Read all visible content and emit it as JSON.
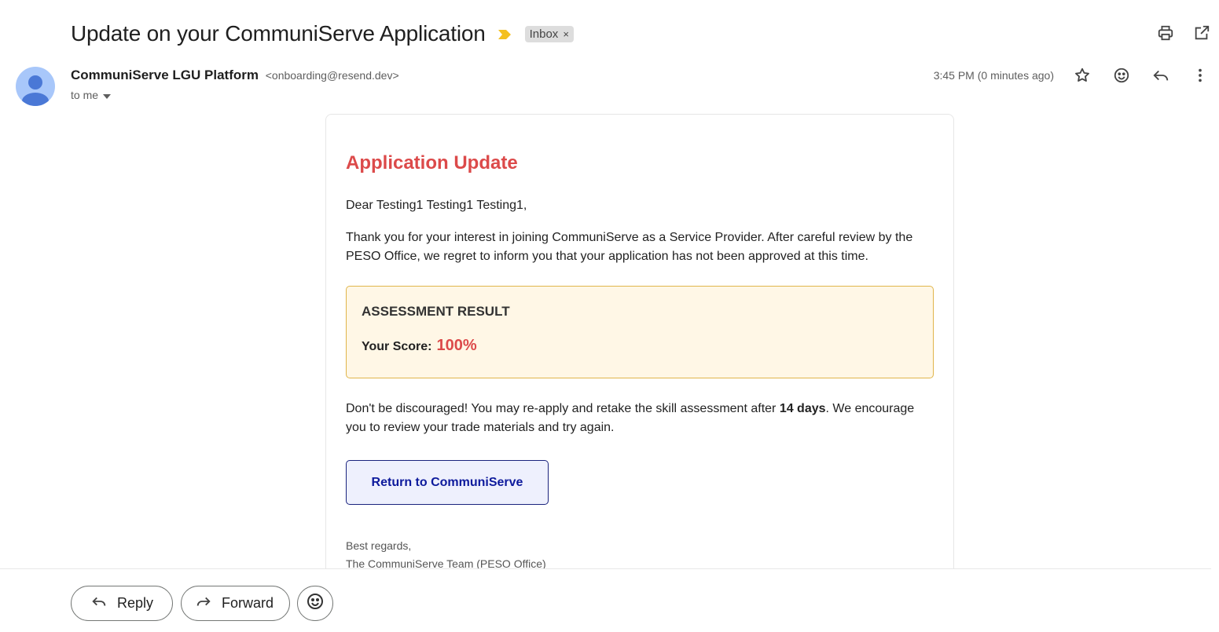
{
  "email": {
    "subject": "Update on your CommuniServe Application",
    "label": "Inbox",
    "label_remove": "×",
    "sender_name": "CommuniServe LGU Platform",
    "sender_email": "<onboarding@resend.dev>",
    "recipient": "to me",
    "timestamp": "3:45 PM (0 minutes ago)"
  },
  "body": {
    "heading": "Application Update",
    "greeting": "Dear Testing1 Testing1 Testing1,",
    "intro": "Thank you for your interest in joining CommuniServe as a Service Provider. After careful review by the PESO Office, we regret to inform you that your application has not been approved at this time.",
    "assessment_title": "ASSESSMENT RESULT",
    "score_label": "Your Score:",
    "score_value": "100%",
    "encourage_pre": "Don't be discouraged! You may re-apply and retake the skill assessment after ",
    "encourage_bold": "14 days",
    "encourage_post": ". We encourage you to review your trade materials and try again.",
    "cta_label": "Return to CommuniServe",
    "signoff_line1": "Best regards,",
    "signoff_line2": "The CommuniServe Team (PESO Office)"
  },
  "actions": {
    "reply_label": "Reply",
    "forward_label": "Forward"
  },
  "icons": {
    "importance": "importance-marker-icon",
    "print": "print-icon",
    "open_new_window": "open-in-new-window-icon",
    "star": "star-icon",
    "emoji": "emoji-icon",
    "reply": "reply-icon",
    "more": "more-vert-icon",
    "forward": "forward-icon",
    "dropdown": "caret-down-icon"
  },
  "colors": {
    "heading": "#dc4a4a",
    "assessment_border": "#e0b54a",
    "assessment_bg": "#fff7e6",
    "cta_text": "#0d1a9c",
    "cta_bg": "#eef0fd",
    "importance": "#f4c01e"
  }
}
